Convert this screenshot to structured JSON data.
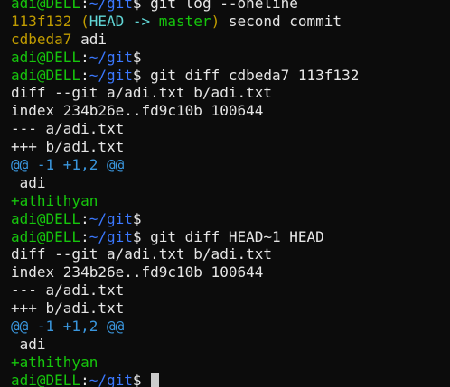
{
  "colors": {
    "background": "#0c0c0c",
    "default": "#e6e6e6",
    "prompt_user": "#16c60c",
    "prompt_path": "#3b78ff",
    "commit_hash": "#c19c00",
    "ref_head": "#61d6d6",
    "ref_branch": "#16c60c",
    "hunk": "#3a96dd",
    "added": "#16c60c",
    "cursor": "#cccccc"
  },
  "terminal": {
    "lines": [
      [
        {
          "text": "adi@DELL",
          "color": "prompt_user"
        },
        {
          "text": ":",
          "color": "default"
        },
        {
          "text": "~/git",
          "color": "prompt_path"
        },
        {
          "text": "$ git log --oneline",
          "color": "default"
        }
      ],
      [
        {
          "text": "113f132 (",
          "color": "commit_hash"
        },
        {
          "text": "HEAD -> ",
          "color": "ref_head"
        },
        {
          "text": "master",
          "color": "ref_branch"
        },
        {
          "text": ")",
          "color": "commit_hash"
        },
        {
          "text": " second commit",
          "color": "default"
        }
      ],
      [
        {
          "text": "cdbeda7",
          "color": "commit_hash"
        },
        {
          "text": " adi",
          "color": "default"
        }
      ],
      [
        {
          "text": "adi@DELL",
          "color": "prompt_user"
        },
        {
          "text": ":",
          "color": "default"
        },
        {
          "text": "~/git",
          "color": "prompt_path"
        },
        {
          "text": "$",
          "color": "default"
        }
      ],
      [
        {
          "text": "adi@DELL",
          "color": "prompt_user"
        },
        {
          "text": ":",
          "color": "default"
        },
        {
          "text": "~/git",
          "color": "prompt_path"
        },
        {
          "text": "$ git diff cdbeda7 113f132",
          "color": "default"
        }
      ],
      [
        {
          "text": "diff --git a/adi.txt b/adi.txt",
          "color": "default"
        }
      ],
      [
        {
          "text": "index 234b26e..fd9c10b 100644",
          "color": "default"
        }
      ],
      [
        {
          "text": "--- a/adi.txt",
          "color": "default"
        }
      ],
      [
        {
          "text": "+++ b/adi.txt",
          "color": "default"
        }
      ],
      [
        {
          "text": "@@ -1 +1,2 @@",
          "color": "hunk"
        }
      ],
      [
        {
          "text": " adi",
          "color": "default"
        }
      ],
      [
        {
          "text": "+athithyan",
          "color": "added"
        }
      ],
      [
        {
          "text": "adi@DELL",
          "color": "prompt_user"
        },
        {
          "text": ":",
          "color": "default"
        },
        {
          "text": "~/git",
          "color": "prompt_path"
        },
        {
          "text": "$",
          "color": "default"
        }
      ],
      [
        {
          "text": "adi@DELL",
          "color": "prompt_user"
        },
        {
          "text": ":",
          "color": "default"
        },
        {
          "text": "~/git",
          "color": "prompt_path"
        },
        {
          "text": "$ git diff HEAD~1 HEAD",
          "color": "default"
        }
      ],
      [
        {
          "text": "diff --git a/adi.txt b/adi.txt",
          "color": "default"
        }
      ],
      [
        {
          "text": "index 234b26e..fd9c10b 100644",
          "color": "default"
        }
      ],
      [
        {
          "text": "--- a/adi.txt",
          "color": "default"
        }
      ],
      [
        {
          "text": "+++ b/adi.txt",
          "color": "default"
        }
      ],
      [
        {
          "text": "@@ -1 +1,2 @@",
          "color": "hunk"
        }
      ],
      [
        {
          "text": " adi",
          "color": "default"
        }
      ],
      [
        {
          "text": "+athithyan",
          "color": "added"
        }
      ],
      [
        {
          "text": "adi@DELL",
          "color": "prompt_user"
        },
        {
          "text": ":",
          "color": "default"
        },
        {
          "text": "~/git",
          "color": "prompt_path"
        },
        {
          "text": "$ ",
          "color": "default"
        }
      ]
    ]
  }
}
